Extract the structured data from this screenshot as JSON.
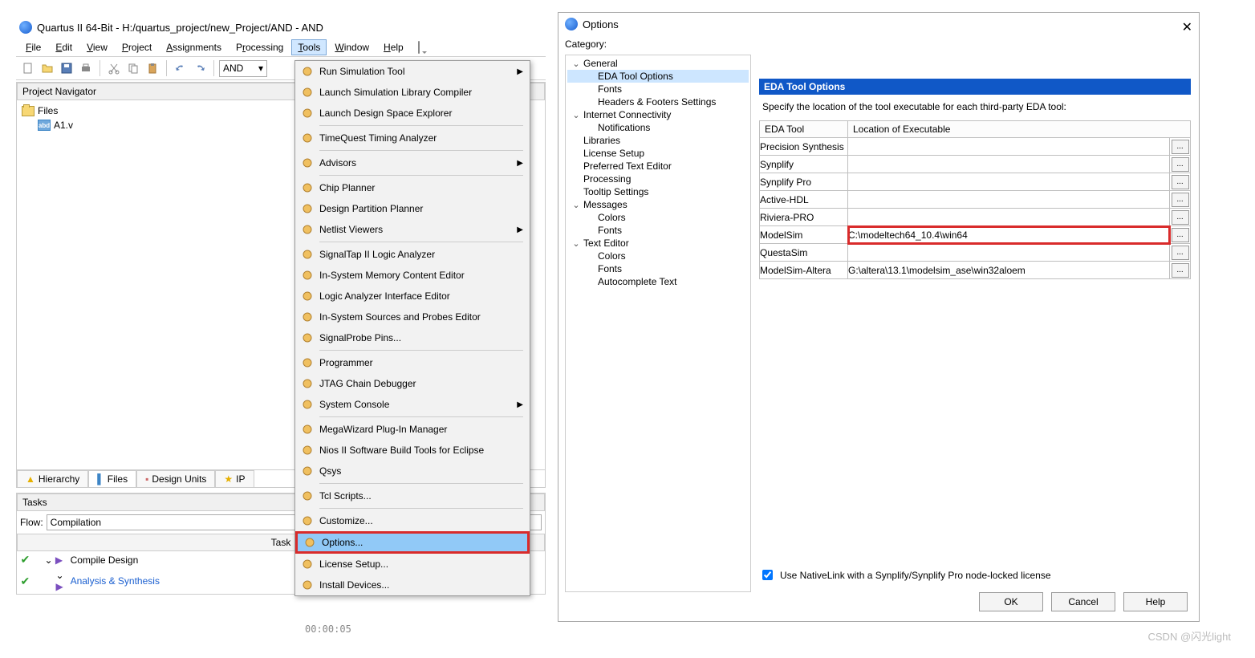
{
  "main_window": {
    "title": "Quartus II 64-Bit - H:/quartus_project/new_Project/AND - AND",
    "menus": [
      "File",
      "Edit",
      "View",
      "Project",
      "Assignments",
      "Processing",
      "Tools",
      "Window",
      "Help"
    ],
    "active_menu": "Tools",
    "combo_value": "AND",
    "project_nav": {
      "title": "Project Navigator",
      "root": "Files",
      "file": "A1.v"
    },
    "tabs": [
      "Hierarchy",
      "Files",
      "Design Units",
      "IP"
    ],
    "tasks": {
      "title": "Tasks",
      "flow_label": "Flow:",
      "flow_value": "Compilation",
      "col_task": "Task",
      "rows": [
        "Compile Design",
        "Analysis & Synthesis"
      ],
      "time": "00:00:05"
    }
  },
  "tools_menu": {
    "items": [
      {
        "label": "Run Simulation Tool",
        "sub": true
      },
      {
        "label": "Launch Simulation Library Compiler"
      },
      {
        "label": "Launch Design Space Explorer"
      },
      {
        "sep": true
      },
      {
        "label": "TimeQuest Timing Analyzer"
      },
      {
        "sep": true
      },
      {
        "label": "Advisors",
        "sub": true
      },
      {
        "sep": true
      },
      {
        "label": "Chip Planner"
      },
      {
        "label": "Design Partition Planner"
      },
      {
        "label": "Netlist Viewers",
        "sub": true
      },
      {
        "sep": true
      },
      {
        "label": "SignalTap II Logic Analyzer"
      },
      {
        "label": "In-System Memory Content Editor"
      },
      {
        "label": "Logic Analyzer Interface Editor"
      },
      {
        "label": "In-System Sources and Probes Editor"
      },
      {
        "label": "SignalProbe Pins..."
      },
      {
        "sep": true
      },
      {
        "label": "Programmer"
      },
      {
        "label": "JTAG Chain Debugger"
      },
      {
        "label": "System Console",
        "sub": true
      },
      {
        "sep": true
      },
      {
        "label": "MegaWizard Plug-In Manager"
      },
      {
        "label": "Nios II Software Build Tools for Eclipse"
      },
      {
        "label": "Qsys"
      },
      {
        "sep": true
      },
      {
        "label": "Tcl Scripts..."
      },
      {
        "sep": true
      },
      {
        "label": "Customize..."
      },
      {
        "label": "Options...",
        "highlight": true
      },
      {
        "label": "License Setup..."
      },
      {
        "label": "Install Devices..."
      }
    ]
  },
  "options_dialog": {
    "title": "Options",
    "category_label": "Category:",
    "tree": {
      "general": {
        "label": "General",
        "children": [
          "EDA Tool Options",
          "Fonts",
          "Headers & Footers Settings"
        ]
      },
      "internet": {
        "label": "Internet Connectivity",
        "children": [
          "Notifications"
        ]
      },
      "flat1": [
        "Libraries",
        "License Setup",
        "Preferred Text Editor",
        "Processing",
        "Tooltip Settings"
      ],
      "messages": {
        "label": "Messages",
        "children": [
          "Colors",
          "Fonts"
        ]
      },
      "texteditor": {
        "label": "Text Editor",
        "children": [
          "Colors",
          "Fonts",
          "Autocomplete Text"
        ]
      }
    },
    "selected": "EDA Tool Options",
    "panel_header": "EDA Tool Options",
    "panel_desc": "Specify the location of the tool executable for each third-party EDA tool:",
    "columns": [
      "EDA Tool",
      "Location of Executable"
    ],
    "rows": [
      {
        "tool": "Precision Synthesis",
        "loc": ""
      },
      {
        "tool": "Synplify",
        "loc": ""
      },
      {
        "tool": "Synplify Pro",
        "loc": ""
      },
      {
        "tool": "Active-HDL",
        "loc": ""
      },
      {
        "tool": "Riviera-PRO",
        "loc": ""
      },
      {
        "tool": "ModelSim",
        "loc": "C:\\modeltech64_10.4\\win64",
        "highlight": true
      },
      {
        "tool": "QuestaSim",
        "loc": ""
      },
      {
        "tool": "ModelSim-Altera",
        "loc": "G:\\altera\\13.1\\modelsim_ase\\win32aloem"
      }
    ],
    "checkbox": "Use NativeLink with a Synplify/Synplify Pro node-locked license",
    "buttons": [
      "OK",
      "Cancel",
      "Help"
    ]
  },
  "watermark": "CSDN @闪光light"
}
